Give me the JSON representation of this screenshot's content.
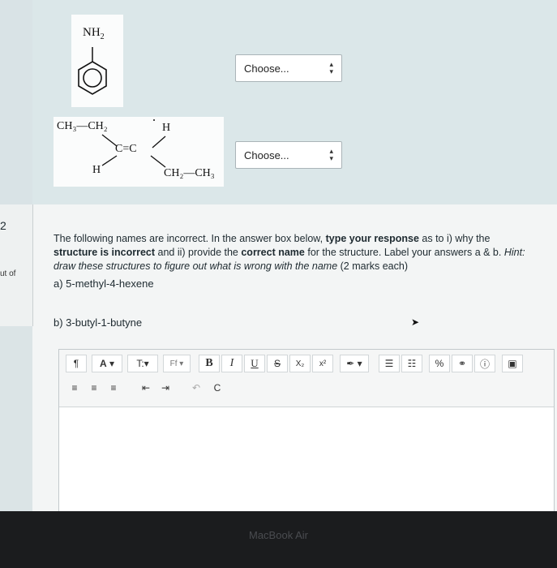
{
  "question_number": "2",
  "points_label": "ut of",
  "molecule1": {
    "group": "NH",
    "group_sub": "2"
  },
  "molecule2": {
    "top_left": "CH₃—CH₂",
    "top_right": "H",
    "center": "C=C",
    "bottom_left": "H",
    "bottom_right": "CH₂—CH₃"
  },
  "dropdowns": [
    {
      "selected": "Choose..."
    },
    {
      "selected": "Choose..."
    }
  ],
  "question": {
    "line1_a": "The following names are incorrect. In the answer box below, ",
    "line1_b": "type your response",
    "line1_c": " as to i) why the",
    "line2_a": "structure is incorrect",
    "line2_b": " and ii) provide the ",
    "line2_c": "correct name",
    "line2_d": " for the structure. Label your answers a & b. ",
    "line2_e": "Hint:",
    "line3": "draw these structures to figure out what is wrong with the name",
    "line3_b": " (2 marks each)",
    "part_a": "a) 5-methyl-4-hexene",
    "part_b": "b) 3-butyl-1-butyne"
  },
  "toolbar": {
    "paragraph": "¶",
    "font_color": "A",
    "text_size": "T:",
    "font_family": "Ff",
    "bold": "B",
    "italic": "I",
    "underline": "U",
    "strikethrough": "S",
    "subscript": "X₂",
    "superscript": "x²",
    "undo": "↶",
    "redo": "C"
  },
  "bezel_label": "MacBook Air"
}
